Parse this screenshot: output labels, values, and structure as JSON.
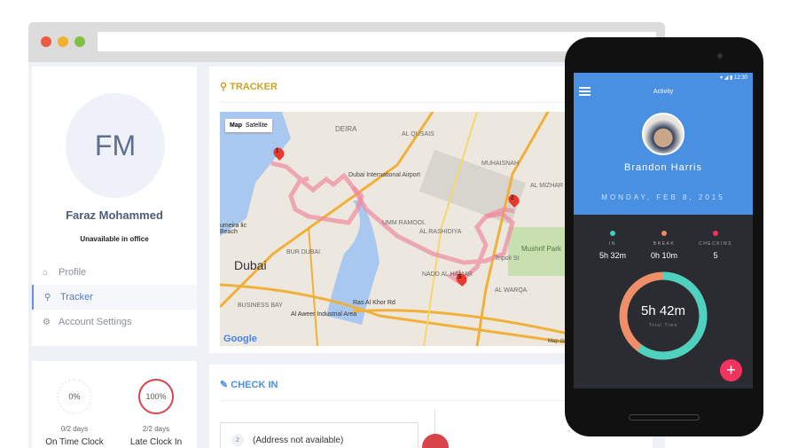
{
  "browser": {
    "dots": [
      "#ee5b45",
      "#f0b12f",
      "#7fc241"
    ]
  },
  "profile": {
    "initials": "FM",
    "name": "Faraz Mohammed",
    "status": "Unavailable in office"
  },
  "nav": [
    {
      "label": "Profile",
      "icon": "home-icon"
    },
    {
      "label": "Tracker",
      "icon": "map-pin-icon",
      "active": true
    },
    {
      "label": "Account Settings",
      "icon": "gear-icon"
    }
  ],
  "tracker": {
    "title": "TRACKER",
    "map_type": {
      "map": "Map",
      "satellite": "Satellite"
    },
    "google": "Google",
    "map_data": "Map da",
    "labels": [
      "DEIRA",
      "Dubai International Airport",
      "AL QUSAIS",
      "MUHAISNAH",
      "AL MIZHAR",
      "UMM RAMOOL",
      "AL RASHIDIYA",
      "Mushrif Park",
      "BUR DUBAI",
      "Dubai",
      "NADD AL HAMAR",
      "AL WARQA",
      "BUSINESS BAY",
      "Al Aweer Industrial Area",
      "umeira lic Beach",
      "Ras Al Khor Rd",
      "Tripoli St"
    ],
    "markers": [
      "1",
      "2",
      "S"
    ]
  },
  "stats": [
    {
      "percent": "0%",
      "days": "0/2 days",
      "label": "On Time Clock"
    },
    {
      "percent": "100%",
      "days": "2/2 days",
      "label": "Late Clock In"
    }
  ],
  "checkin": {
    "title": "CHECK IN",
    "entry_num": "2",
    "entry": "(Address not available)"
  },
  "phone": {
    "time": "12:30",
    "title": "Activity",
    "user": "Brandon Harris",
    "date": "MONDAY, FEB 8, 2015",
    "stats": [
      {
        "label": "IN",
        "value": "5h 32m",
        "color": "#3fd1bd"
      },
      {
        "label": "BREAK",
        "value": "0h 10m",
        "color": "#f08a60"
      },
      {
        "label": "CHECKINS",
        "value": "5",
        "color": "#f2335d"
      }
    ],
    "total": "5h 42m",
    "total_label": "Total Time",
    "ring": {
      "in_fraction": 0.6,
      "break_fraction": 0.4,
      "in_color": "#4fd1c0",
      "break_color": "#ee8f6a"
    },
    "fab": "+"
  }
}
